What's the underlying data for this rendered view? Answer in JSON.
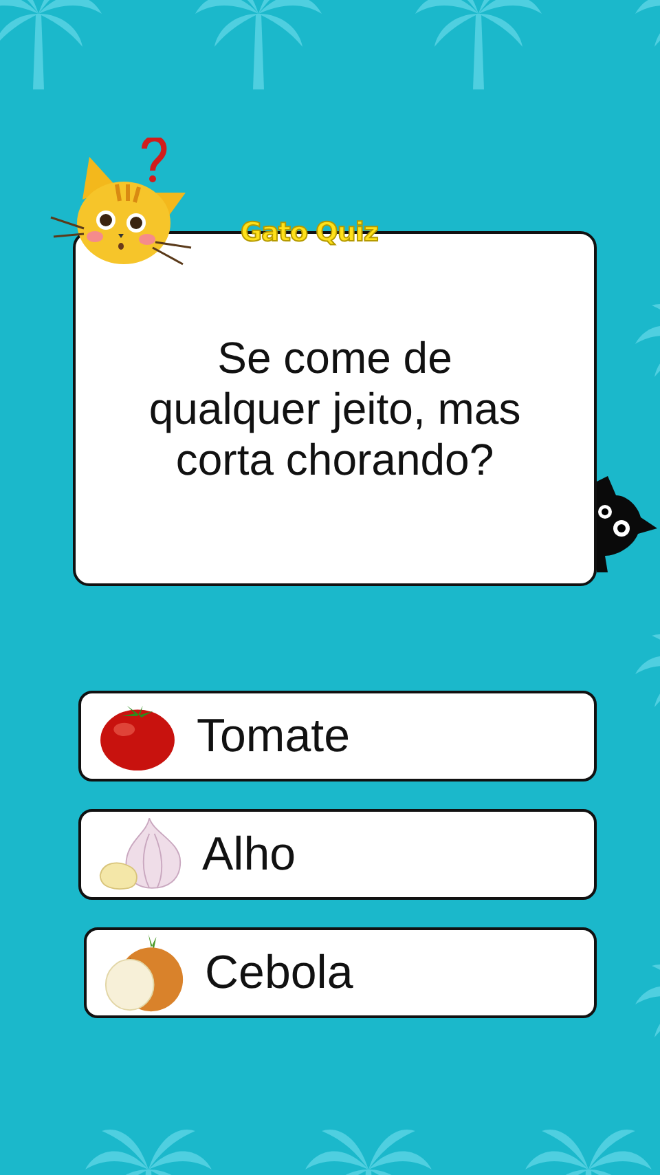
{
  "logo": "Gato Quiz",
  "question": "Se come de qualquer jeito, mas corta chorando?",
  "answers": [
    {
      "label": "Tomate",
      "kind": "tomato"
    },
    {
      "label": "Alho",
      "kind": "garlic"
    },
    {
      "label": "Cebola",
      "kind": "onion"
    }
  ]
}
